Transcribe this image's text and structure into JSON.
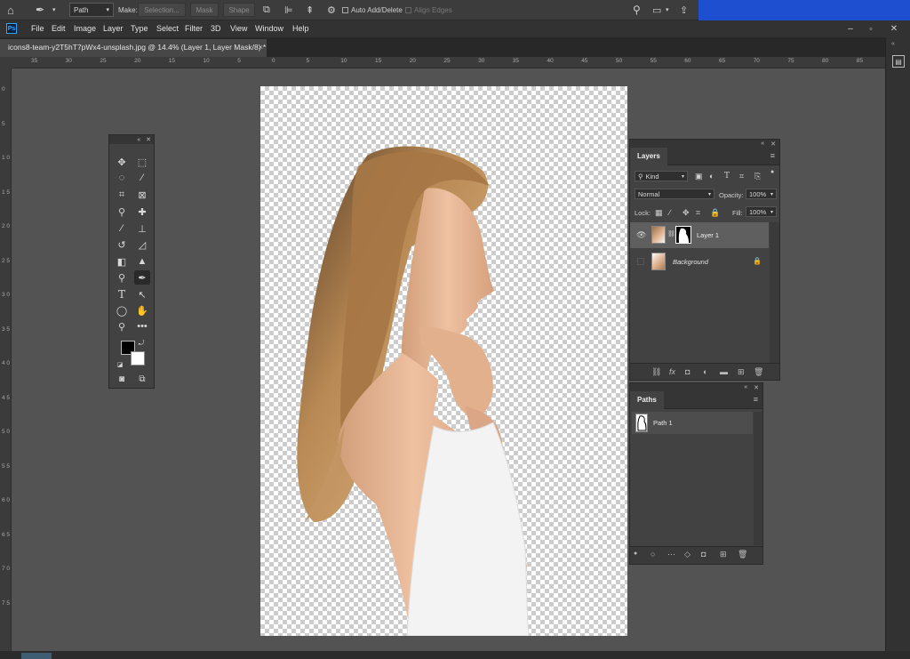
{
  "options_bar": {
    "mode_value": "Path",
    "make_label": "Make:",
    "selection_label": "Selection...",
    "mask_label": "Mask",
    "shape_label": "Shape",
    "auto_add_delete_label": "Auto Add/Delete",
    "align_edges_label": "Align Edges"
  },
  "menu": {
    "items": [
      "File",
      "Edit",
      "Image",
      "Layer",
      "Type",
      "Select",
      "Filter",
      "3D",
      "View",
      "Window",
      "Help"
    ],
    "logo": "Ps"
  },
  "document_tab": {
    "title": "icons8-team-y2T5hT7pWx4-unsplash.jpg @ 14.4% (Layer 1, Layer Mask/8) *",
    "close": "×"
  },
  "rulers": {
    "top": [
      "35",
      "30",
      "25",
      "20",
      "15",
      "10",
      "5",
      "0",
      "5",
      "10",
      "15",
      "20",
      "25",
      "30",
      "35",
      "40",
      "45",
      "50",
      "55",
      "60",
      "65",
      "70",
      "75",
      "80",
      "85"
    ],
    "left": [
      "0",
      "5",
      "1 0",
      "1 5",
      "2 0",
      "2 5",
      "3 0",
      "3 5",
      "4 0",
      "4 5",
      "5 0",
      "5 5",
      "6 0",
      "6 5",
      "7 0",
      "7 5"
    ]
  },
  "layers_panel": {
    "tab": "Layers",
    "kind_value": "Kind",
    "blend_mode": "Normal",
    "opacity_label": "Opacity:",
    "opacity_value": "100%",
    "lock_label": "Lock:",
    "fill_label": "Fill:",
    "fill_value": "100%",
    "layers": [
      {
        "name": "Layer 1",
        "visible": true,
        "selected": true
      },
      {
        "name": "Background",
        "visible": false,
        "selected": false,
        "locked": true
      }
    ]
  },
  "paths_panel": {
    "tab": "Paths",
    "paths": [
      "Path 1"
    ]
  },
  "colors": {
    "foreground": "#000000",
    "background": "#ffffff",
    "taskbar_blue": "#1f4fd1"
  }
}
